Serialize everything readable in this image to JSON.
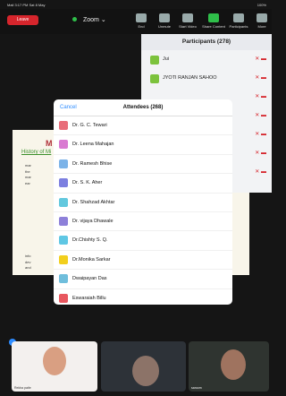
{
  "status": {
    "carrier": "Mail  3:17 PM  Sat 8 May",
    "battery": "100%"
  },
  "toolbar": {
    "leave": "Leave",
    "zoom": "Zoom",
    "items": [
      {
        "label": "End",
        "icon": "end-icon"
      },
      {
        "label": "Unmute",
        "icon": "microphone-icon"
      },
      {
        "label": "Start Video",
        "icon": "video-icon"
      },
      {
        "label": "Share Content",
        "icon": "share-icon"
      },
      {
        "label": "Participants",
        "icon": "participants-icon"
      },
      {
        "label": "More",
        "icon": "more-icon"
      }
    ]
  },
  "slide": {
    "title": "M",
    "link": "History of Mi",
    "bullets": [
      " mar",
      " the",
      " mar",
      " ear",
      " info",
      " dev",
      " and"
    ]
  },
  "participants": {
    "title": "Participants (278)",
    "rows": [
      {
        "name": "Jui",
        "color": "#7cc23c"
      },
      {
        "name": "JYOTI RANJAN SAHOO",
        "color": "#7cc23c"
      }
    ]
  },
  "attendees": {
    "title": "Attendees (268)",
    "cancel": "Cancel",
    "items": [
      {
        "name": "Dr. G. C. Tewari",
        "color": "#e86d7a"
      },
      {
        "name": "Dr. Leena Mahajan",
        "color": "#d97ad1"
      },
      {
        "name": "Dr. Ramesh Bhise",
        "color": "#7cb3e8"
      },
      {
        "name": "Dr. S. K. Aher",
        "color": "#7c7fe0"
      },
      {
        "name": "Dr. Shahzad Akhtar",
        "color": "#62c8de"
      },
      {
        "name": "Dr. vijaya Dhawale",
        "color": "#8d80d9"
      },
      {
        "name": "Dr.Chishty S. Q.",
        "color": "#5fc7e4"
      },
      {
        "name": "Dr.Monika Sarkar",
        "color": "#f2cf1d"
      },
      {
        "name": "Dwaipayan Das",
        "color": "#6fbedc"
      },
      {
        "name": "Eswaraiah Billu",
        "color": "#e8575f"
      }
    ]
  },
  "videos": [
    {
      "name": "Rekha patle"
    },
    {
      "name": ""
    },
    {
      "name": "saroom"
    }
  ]
}
